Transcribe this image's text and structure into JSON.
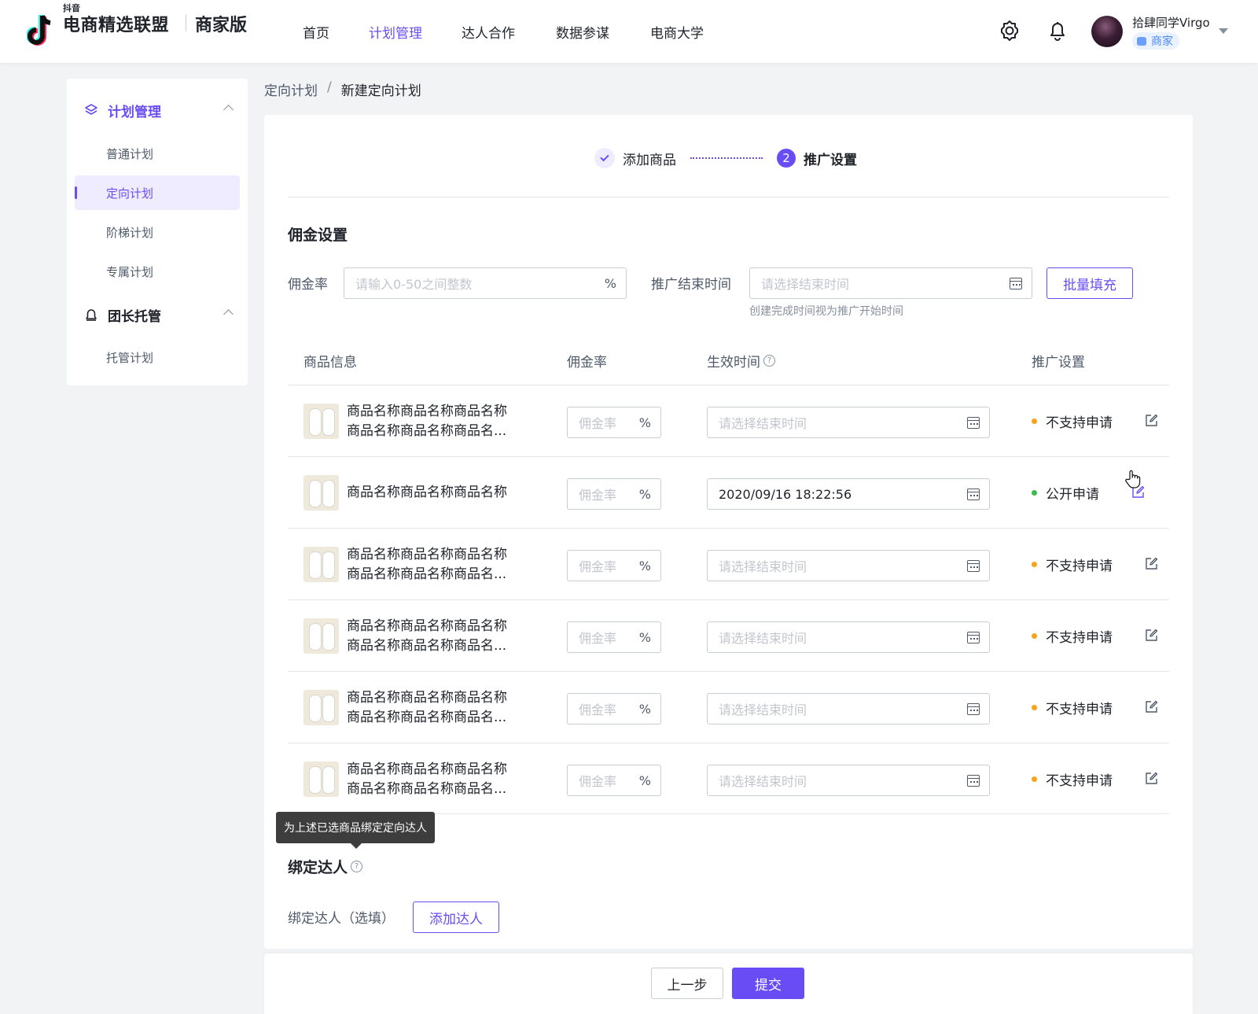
{
  "colors": {
    "primary": "#6a4cf5",
    "warning_dot": "#f7a31b",
    "success_dot": "#3bbb4d"
  },
  "brand": {
    "small": "抖音",
    "main": "电商精选联盟",
    "edition": "商家版"
  },
  "nav": [
    {
      "label": "首页",
      "active": false
    },
    {
      "label": "计划管理",
      "active": true
    },
    {
      "label": "达人合作",
      "active": false
    },
    {
      "label": "数据参谋",
      "active": false
    },
    {
      "label": "电商大学",
      "active": false
    }
  ],
  "header": {
    "icons": [
      "settings-icon",
      "bell-icon"
    ]
  },
  "user": {
    "name": "拾肆同学Virgo",
    "role": "商家"
  },
  "sidebar": {
    "group1": {
      "label": "计划管理",
      "icon": "layers-icon"
    },
    "items1": [
      "普通计划",
      "定向计划",
      "阶梯计划",
      "专属计划"
    ],
    "group2": {
      "label": "团长托管",
      "icon": "bell-badge-icon"
    },
    "items2": [
      "托管计划"
    ]
  },
  "breadcrumb": {
    "parent": "定向计划",
    "sep": "/",
    "current": "新建定向计划"
  },
  "steps": {
    "step1": "添加商品",
    "step2_num": "2",
    "step2": "推广设置"
  },
  "commission": {
    "title": "佣金设置",
    "rate_label": "佣金率",
    "rate_placeholder": "请输入0-50之间整数",
    "rate_suffix": "%",
    "end_label": "推广结束时间",
    "end_placeholder": "请选择结束时间",
    "end_hint": "创建完成时间视为推广开始时间",
    "batch_button": "批量填充"
  },
  "table": {
    "headers": {
      "product": "商品信息",
      "rate": "佣金率",
      "time": "生效时间",
      "promo": "推广设置"
    },
    "rate_placeholder": "佣金率",
    "rate_suffix": "%",
    "time_placeholder": "请选择结束时间",
    "rows": [
      {
        "line1": "商品名称商品名称商品名称",
        "line2": "商品名称商品名称商品名...",
        "time": "",
        "status": "不支持申请"
      },
      {
        "line1": "商品名称商品名称商品名称",
        "line2": "",
        "time": "2020/09/16 18:22:56",
        "status": "公开申请"
      },
      {
        "line1": "商品名称商品名称商品名称",
        "line2": "商品名称商品名称商品名...",
        "time": "",
        "status": "不支持申请"
      },
      {
        "line1": "商品名称商品名称商品名称",
        "line2": "商品名称商品名称商品名...",
        "time": "",
        "status": "不支持申请"
      },
      {
        "line1": "商品名称商品名称商品名称",
        "line2": "商品名称商品名称商品名...",
        "time": "",
        "status": "不支持申请"
      },
      {
        "line1": "商品名称商品名称商品名称",
        "line2": "商品名称商品名称商品名...",
        "time": "",
        "status": "不支持申请"
      }
    ]
  },
  "bind": {
    "tooltip": "为上述已选商品绑定定向达人",
    "title": "绑定达人",
    "label": "绑定达人（选填）",
    "button": "添加达人"
  },
  "footer": {
    "prev": "上一步",
    "submit": "提交"
  }
}
